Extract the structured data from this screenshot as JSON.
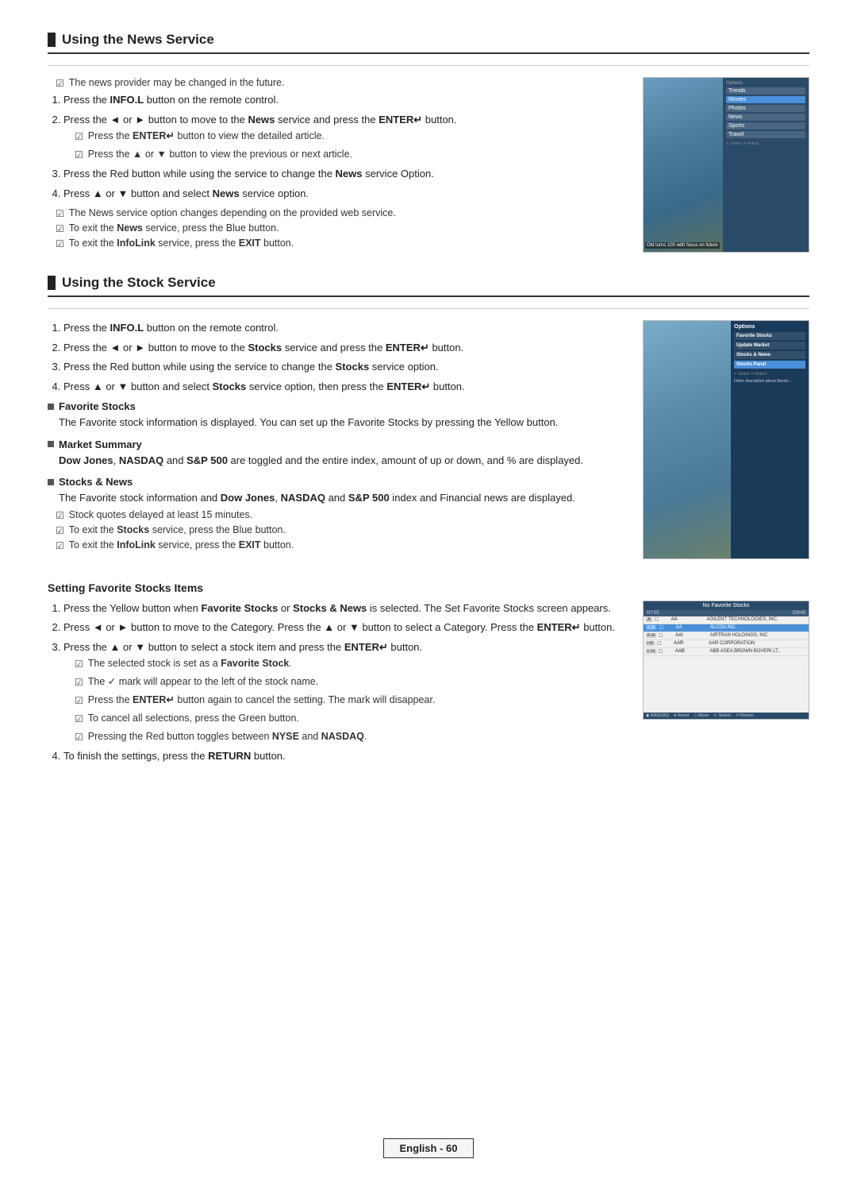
{
  "page": {
    "footer": "English - 60"
  },
  "news_section": {
    "title": "Using the News Service",
    "note1": "The news provider may be changed in the future.",
    "steps": [
      {
        "id": 1,
        "text": "Press the INFO.L button on the remote control.",
        "bold_parts": [
          "INFO.L"
        ]
      },
      {
        "id": 2,
        "text": "Press the ◄ or ► button to move to the News service and press the ENTER↵ button.",
        "sub_notes": [
          "Press the ENTER↵ button to view the detailed article.",
          "Press the ▲ or ▼ button to view the previous or next article."
        ]
      },
      {
        "id": 3,
        "text": "Press the Red button while using the service to change the News service Option."
      },
      {
        "id": 4,
        "text": "Press ▲ or ▼ button and select News service option."
      }
    ],
    "bottom_notes": [
      "The News service option changes depending on the provided web service.",
      "To exit the News service, press the Blue button.",
      "To exit the InfoLink service, press the EXIT button."
    ]
  },
  "stock_section": {
    "title": "Using the Stock Service",
    "steps": [
      {
        "id": 1,
        "text": "Press the INFO.L button on the remote control."
      },
      {
        "id": 2,
        "text": "Press the ◄ or ► button to move to the Stocks service and press the ENTER↵ button."
      },
      {
        "id": 3,
        "text": "Press the Red button while using the service to change the Stocks service option."
      },
      {
        "id": 4,
        "text": "Press ▲ or ▼ button and select Stocks service option, then press the ENTER↵ button."
      }
    ],
    "sub_sections": [
      {
        "title": "Favorite Stocks",
        "body": "The Favorite stock information is displayed. You can set up the Favorite Stocks by pressing the Yellow button."
      },
      {
        "title": "Market Summary",
        "body": "Dow Jones, NASDAQ and S&P 500 are toggled and the entire index, amount of up or down, and % are displayed.",
        "bold_parts": [
          "Dow Jones,",
          "NASDAQ",
          "S&P 500"
        ]
      },
      {
        "title": "Stocks & News",
        "body": "The Favorite stock information and Dow Jones, NASDAQ and S&P 500 index and Financial news are displayed.",
        "notes": [
          "Stock quotes delayed at least 15 minutes.",
          "To exit the Stocks service, press the Blue button.",
          "To exit the InfoLink service, press the EXIT button."
        ]
      }
    ]
  },
  "setting_section": {
    "title": "Setting Favorite Stocks Items",
    "steps": [
      {
        "id": 1,
        "text": "Press the Yellow button when Favorite Stocks or Stocks & News is selected. The Set Favorite Stocks screen appears."
      },
      {
        "id": 2,
        "text": "Press ◄ or ► button to move to the Category. Press the ▲ or ▼ button to select a Category. Press the ENTER↵ button."
      },
      {
        "id": 3,
        "text": "Press the ▲ or ▼ button to select a stock item and press the ENTER↵ button.",
        "sub_notes": [
          "The selected stock is set as a Favorite Stock.",
          "The ✓ mark will appear to the left of the stock name.",
          "Press the ENTER↵ button again to cancel the setting. The mark will disappear.",
          "To cancel all selections, press the Green button.",
          "Pressing the Red button toggles between NYSE and NASDAQ."
        ]
      },
      {
        "id": 4,
        "text": "To finish the settings, press the RETURN button."
      }
    ],
    "fav_stocks_img": {
      "header": "No Favorite Stocks",
      "exchange": "NYSE",
      "date": "3/9/48",
      "rows": [
        {
          "tag": "A",
          "code": "A",
          "name": "AGILENT TECHNOLOGIES, INC.",
          "selected": false
        },
        {
          "tag": "C-E",
          "code": "AA",
          "name": "ALCOA INC.",
          "selected": true
        },
        {
          "tag": "F-H",
          "code": "AAI",
          "name": "AIRTRAN HOLDINGS, INC",
          "selected": false
        },
        {
          "tag": "I-K",
          "code": "AAR",
          "name": "AAR CORPORATION",
          "selected": false
        },
        {
          "tag": "L-H",
          "code": "AAB",
          "name": "ABB ASEA BROWN BOVERI LT..",
          "selected": false
        }
      ],
      "footer_items": [
        "● Reset",
        "◇ Move",
        "↵ Select",
        "⏎ Return"
      ]
    }
  }
}
